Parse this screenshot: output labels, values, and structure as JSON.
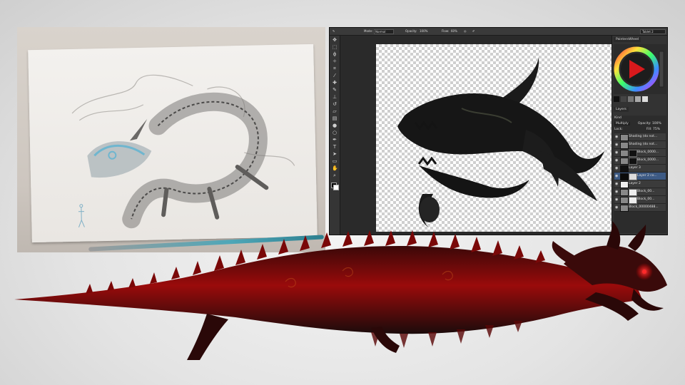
{
  "photoshop": {
    "options_bar": {
      "mode_label": "Mode:",
      "mode_value": "Normal",
      "opacity_label": "Opacity:",
      "opacity_value": "100%",
      "flow_label": "Flow:",
      "flow_value": "60%",
      "workspace_value": "Tablet 2"
    },
    "panels": {
      "color_tab": "PaintersWheel",
      "layers_tab": "Layers",
      "kind_label": "Kind",
      "blend_mode": "Multiply",
      "opacity_label": "Opacity:",
      "opacity_value": "100%",
      "lock_label": "Lock:",
      "fill_label": "Fill:",
      "fill_value": "75%",
      "layers": [
        {
          "name": "Shading (do not..."
        },
        {
          "name": "Shading (do not..."
        },
        {
          "name": "Block_0000..."
        },
        {
          "name": "Block_0000..."
        },
        {
          "name": "Layer 3"
        },
        {
          "name": "Layer 2 co..."
        },
        {
          "name": "Layer 2"
        },
        {
          "name": "Block_00..."
        },
        {
          "name": "Block_00..."
        },
        {
          "name": "Block_00000488..."
        }
      ],
      "selected_layer_index": 5
    }
  },
  "colors": {
    "ps_background": "#262626",
    "layer_selected": "#3d5a84",
    "dragon_red": "#9a0b0b",
    "dragon_dark": "#1b0b0b",
    "canvas_dragon": "#1a1a1a",
    "sketch_blue": "#6fb6cf"
  },
  "icons": [
    "move-icon",
    "marquee-icon",
    "lasso-icon",
    "wand-icon",
    "crop-icon",
    "eyedropper-icon",
    "healing-icon",
    "brush-icon",
    "stamp-icon",
    "history-brush-icon",
    "eraser-icon",
    "gradient-icon",
    "blur-icon",
    "dodge-icon",
    "pen-icon",
    "type-icon",
    "path-select-icon",
    "shape-icon",
    "hand-icon",
    "zoom-icon",
    "color-swatch-icon",
    "eye-icon"
  ]
}
